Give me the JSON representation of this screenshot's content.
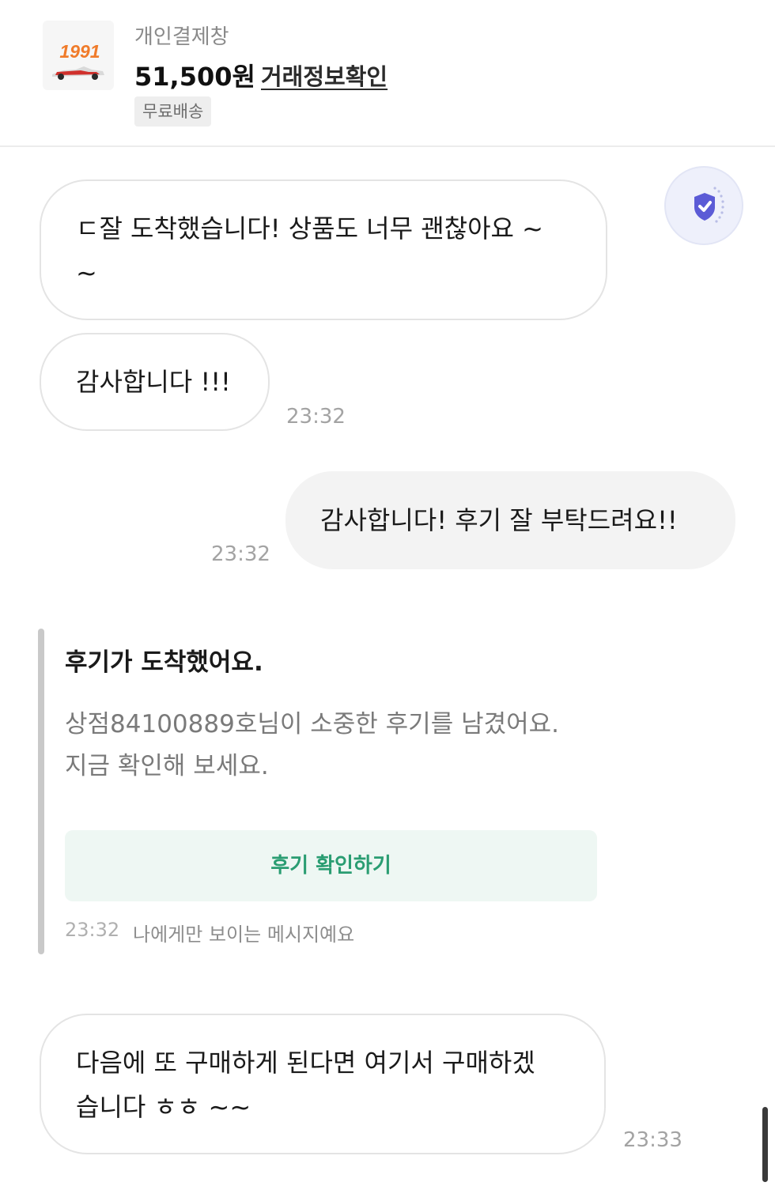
{
  "header": {
    "thumbnail_text": "1991",
    "title": "개인결제창",
    "price": "51,500원",
    "deal_info_link": "거래정보확인",
    "shipping_badge": "무료배송"
  },
  "messages": [
    {
      "direction": "in",
      "lines": [
        "ㄷ잘 도착했습니다! 상품도 너무 괜찮아요 ~",
        "~"
      ]
    },
    {
      "direction": "in",
      "text": "감사합니다 !!!",
      "time": "23:32"
    },
    {
      "direction": "out",
      "text": "감사합니다! 후기 잘 부탁드려요!!",
      "time": "23:32"
    },
    {
      "direction": "in",
      "lines": [
        "다음에 또 구매하게 된다면 여기서 구매하겠",
        "습니다 ㅎㅎ ~~"
      ],
      "time": "23:33"
    }
  ],
  "review_notice": {
    "title": "후기가 도착했어요.",
    "body_line1": "상점84100889호님이 소중한 후기를 남겼어요.",
    "body_line2": "지금 확인해 보세요.",
    "button_label": "후기 확인하기",
    "time": "23:32",
    "visibility_note": "나에게만 보이는 메시지예요"
  },
  "icons": {
    "security_badge": "shield-check-icon",
    "security_color": "#5b5bd6"
  }
}
